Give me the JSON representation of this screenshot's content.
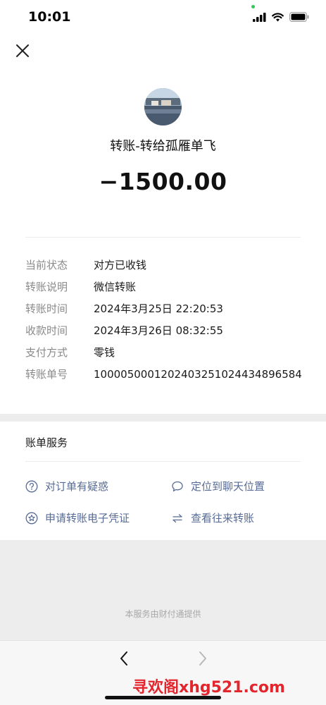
{
  "status_bar": {
    "time": "10:01"
  },
  "header": {
    "close_icon": "close-icon"
  },
  "payee": {
    "title": "转账-转给孤雁单飞",
    "amount": "−1500.00"
  },
  "details": [
    {
      "label": "当前状态",
      "value": "对方已收钱"
    },
    {
      "label": "转账说明",
      "value": "微信转账"
    },
    {
      "label": "转账时间",
      "value": "2024年3月25日 22:20:53"
    },
    {
      "label": "收款时间",
      "value": "2024年3月26日 08:32:55"
    },
    {
      "label": "支付方式",
      "value": "零钱"
    },
    {
      "label": "转账单号",
      "value": "1000050001202403251024434896584"
    }
  ],
  "bill_services": {
    "title": "账单服务",
    "items": [
      {
        "label": "对订单有疑惑",
        "icon": "question-circle-icon"
      },
      {
        "label": "定位到聊天位置",
        "icon": "chat-bubble-icon"
      },
      {
        "label": "申请转账电子凭证",
        "icon": "badge-star-icon"
      },
      {
        "label": "查看往来转账",
        "icon": "swap-arrows-icon"
      }
    ]
  },
  "footer": {
    "note": "本服务由财付通提供"
  },
  "watermark": "寻欢阁xhg521.com",
  "colors": {
    "link": "#576b95",
    "background_grey": "#ededed",
    "watermark": "#e3262e",
    "signal_dot": "#35c759"
  }
}
